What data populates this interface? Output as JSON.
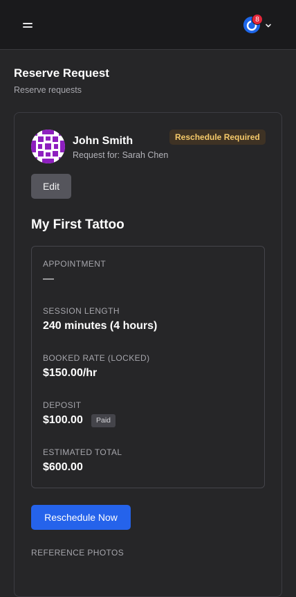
{
  "header": {
    "menu_icon": "hamburger-menu-icon",
    "notifications_count": "8",
    "account_chevron_icon": "chevron-down-icon"
  },
  "page": {
    "title": "Reserve Request",
    "subtitle": "Reserve requests"
  },
  "request": {
    "client_name": "John Smith",
    "request_for": "Request for: Sarah Chen",
    "status": "Reschedule Required",
    "edit_label": "Edit",
    "tattoo_title": "My First Tattoo",
    "fields": [
      {
        "label": "APPOINTMENT",
        "value": "—"
      },
      {
        "label": "SESSION LENGTH",
        "value": "240 minutes (4 hours)"
      },
      {
        "label": "BOOKED RATE (LOCKED)",
        "value": "$150.00/hr"
      },
      {
        "label": "DEPOSIT",
        "value": "$100.00",
        "badge": "Paid"
      },
      {
        "label": "ESTIMATED TOTAL",
        "value": "$600.00"
      }
    ],
    "reschedule_label": "Reschedule Now",
    "reference_photos_label": "REFERENCE PHOTOS"
  },
  "colors": {
    "primary": "#2563eb",
    "status_badge_bg": "#3e3224",
    "status_badge_text": "#f5c96a",
    "notification": "#e3263a",
    "avatar_purple": "#8e1fbf"
  }
}
